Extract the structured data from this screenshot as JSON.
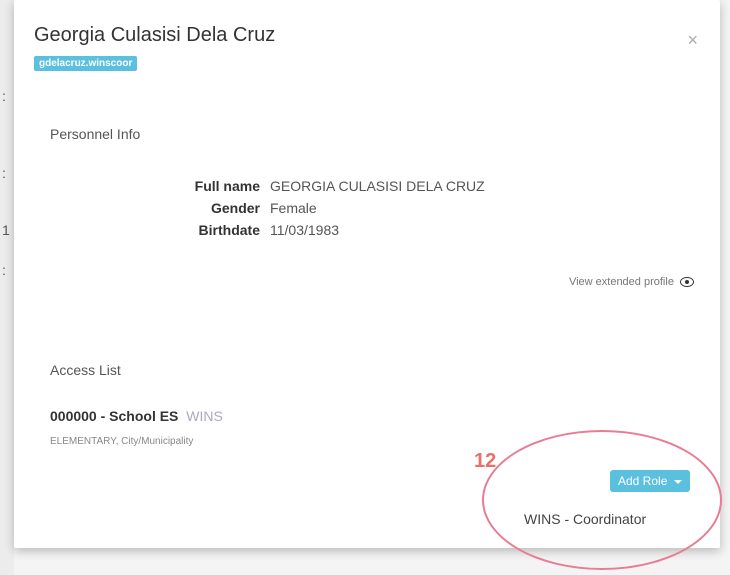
{
  "modal": {
    "title": "Georgia Culasisi Dela Cruz",
    "username_badge": "gdelacruz.winscoor",
    "close_symbol": "×"
  },
  "personnel": {
    "heading": "Personnel Info",
    "fields": [
      {
        "label": "Full name",
        "value": "GEORGIA CULASISI DELA CRUZ"
      },
      {
        "label": "Gender",
        "value": "Female"
      },
      {
        "label": "Birthdate",
        "value": "11/03/1983"
      }
    ],
    "extended_profile_link": "View extended profile"
  },
  "access": {
    "heading": "Access List",
    "school_code": "000000 - School ES",
    "school_tag": "WINS",
    "school_subtitle": "ELEMENTARY, City/Municipality",
    "add_role_label": "Add Role",
    "roles": [
      "WINS - Coordinator"
    ]
  },
  "annotation": {
    "number": "12",
    "color": "#e8706b"
  },
  "colors": {
    "badge": "#5bc0de",
    "button": "#5bc0de"
  },
  "icons": {
    "close": "close-icon",
    "eye": "eye-icon",
    "caret": "caret-down-icon"
  }
}
